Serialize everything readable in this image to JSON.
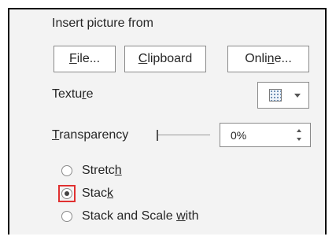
{
  "insert_picture": {
    "heading": "Insert picture from",
    "file": {
      "pre": "",
      "key": "F",
      "post": "ile..."
    },
    "clipboard": {
      "pre": "",
      "key": "C",
      "post": "lipboard"
    },
    "online": {
      "pre": "Onli",
      "key": "n",
      "post": "e..."
    }
  },
  "texture": {
    "pre": "Textu",
    "key": "r",
    "post": "e",
    "icon": "texture-swatch-icon"
  },
  "transparency": {
    "pre": "",
    "key": "T",
    "post": "ransparency",
    "value": "0%",
    "level": 0
  },
  "fill_options": {
    "stretch": {
      "pre": "Stretc",
      "key": "h",
      "post": "",
      "checked": false
    },
    "stack": {
      "pre": "Stac",
      "key": "k",
      "post": "",
      "checked": true
    },
    "stack_scale": {
      "pre": "Stack and Scale ",
      "key": "w",
      "post": "ith",
      "checked": false
    }
  },
  "colors": {
    "highlight": "#e03030",
    "panel": "#f3f3f3"
  }
}
